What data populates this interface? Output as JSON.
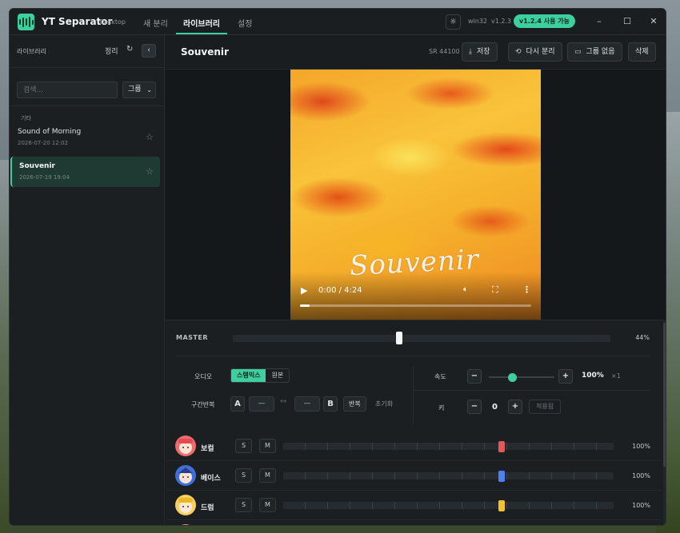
{
  "window": {
    "app_title": "YT Separator",
    "app_subtitle": "Desktop",
    "tabs": [
      {
        "label": "새 분리",
        "active": false
      },
      {
        "label": "라이브러리",
        "active": true
      },
      {
        "label": "설정",
        "active": false
      }
    ],
    "theme_icon": "sun-icon",
    "platform": "win32",
    "version": "v1.2.3",
    "update_badge": "v1.2.4 사용 가능",
    "controls": {
      "minimize": "–",
      "maximize": "☐",
      "close": "✕"
    }
  },
  "sidebar": {
    "title": "라이브러리",
    "sort_label": "정리",
    "refresh_icon": "↻",
    "collapse_icon": "‹",
    "search_placeholder": "검색...",
    "group_select": "그룹",
    "category": "기타",
    "items": [
      {
        "name": "Sound of Morning",
        "date": "2026-07-20 12:02",
        "star": "☆",
        "active": false
      },
      {
        "name": "Souvenir",
        "date": "2026-07-19 19:04",
        "star": "☆",
        "active": true
      }
    ]
  },
  "main": {
    "title": "Souvenir",
    "sample_rate": "SR 44100",
    "buttons": {
      "save": "저장",
      "re_separate": "다시 분리",
      "group": "그룹 없음",
      "delete": "삭제"
    },
    "video": {
      "script_text": "Souvenir",
      "time": "0:00 / 4:24",
      "progress": 0.04
    }
  },
  "mixer": {
    "master_label": "MASTER",
    "master_value": 44,
    "master_pct": "44%",
    "audio_label": "오디오",
    "audio_options": [
      {
        "label": "스템믹스",
        "on": true
      },
      {
        "label": "원본",
        "on": false
      }
    ],
    "loop_label": "구간반복",
    "a_label": "A",
    "a_value": "—",
    "arrow": "↔",
    "b_value": "—",
    "b_label": "B",
    "repeat_label": "반복",
    "reset_label": "초기화",
    "speed_label": "속도",
    "speed_value": "100%",
    "speed_mult": "×1",
    "speed_level": 0.35,
    "key_label": "키",
    "key_value": "0",
    "apply_label": "적용됨",
    "minus": "−",
    "plus": "+",
    "solo": "S",
    "mute": "M",
    "stems": [
      {
        "name": "보컬",
        "pct": "100%",
        "value": 0.66,
        "color": "#e05a5a"
      },
      {
        "name": "베이스",
        "pct": "100%",
        "value": 0.66,
        "color": "#4f7ff0"
      },
      {
        "name": "드럼",
        "pct": "100%",
        "value": 0.66,
        "color": "#f2c230"
      }
    ]
  }
}
